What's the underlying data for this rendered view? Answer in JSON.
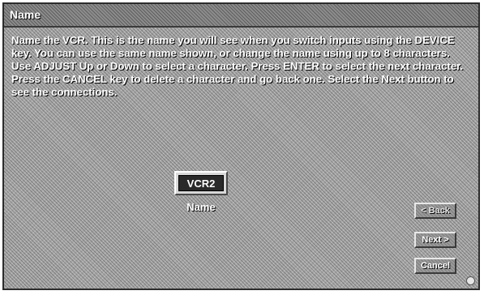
{
  "window": {
    "title": "Name"
  },
  "instructions": "Name the VCR. This is the name you will see when you switch inputs using the DEVICE key. You can use the same name shown, or change the name using up to 8 characters. Use ADJUST Up or Down to select a character. Press ENTER to select the next character. Press the CANCEL key to delete a character and go back one. Select the Next button to see the connections.",
  "name_field": {
    "value": "VCR2",
    "label": "Name"
  },
  "buttons": {
    "back": "< Back",
    "next": "Next >",
    "cancel": "Cancel"
  },
  "icons": {
    "corner": "circle-icon"
  }
}
